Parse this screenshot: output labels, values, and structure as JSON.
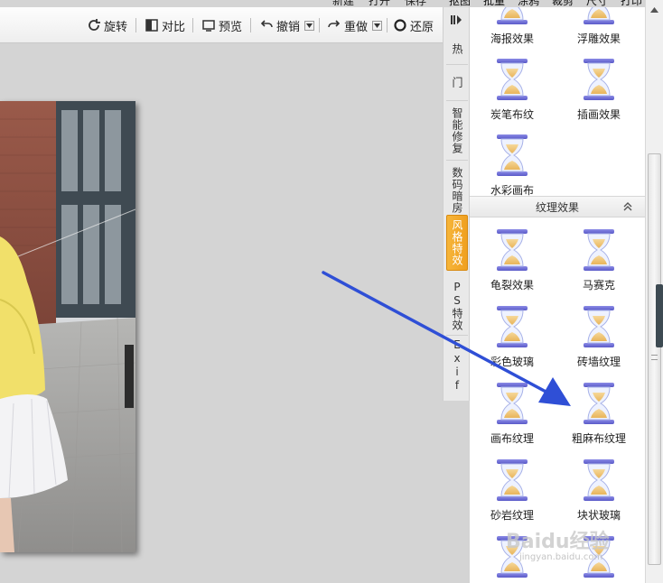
{
  "menu": {
    "items": [
      "新建",
      "打开",
      "保存",
      "抠图",
      "批量",
      "涂鸦",
      "裁剪",
      "尺寸",
      "打印"
    ]
  },
  "toolbar": {
    "rotate": "旋转",
    "compare": "对比",
    "preview": "预览",
    "undo": "撤销",
    "redo": "重做",
    "restore": "还原"
  },
  "tabs": [
    {
      "label": "热",
      "active": false
    },
    {
      "label": "门",
      "active": false
    },
    {
      "label": "智能修复",
      "active": false
    },
    {
      "label": "数码暗房",
      "active": false
    },
    {
      "label": "风格特效",
      "active": true
    },
    {
      "label": "PS特效",
      "active": false
    },
    {
      "label": "Exif",
      "active": false
    }
  ],
  "panel": {
    "top_items": [
      "海报效果",
      "浮雕效果",
      "炭笔布纹",
      "插画效果",
      "水彩画布"
    ],
    "section_title": "纹理效果",
    "texture_items": [
      "龟裂效果",
      "马赛克",
      "彩色玻璃",
      "砖墙纹理",
      "画布纹理",
      "粗麻布纹理",
      "砂岩纹理",
      "块状玻璃",
      "",
      ""
    ]
  },
  "watermark": {
    "text": "Baidu经验",
    "sub": "jingyan.baidu.com"
  },
  "colors": {
    "accent_tab": "#f0a020",
    "arrow": "#2f4fd6",
    "hourglass": "#6f6fd8"
  }
}
